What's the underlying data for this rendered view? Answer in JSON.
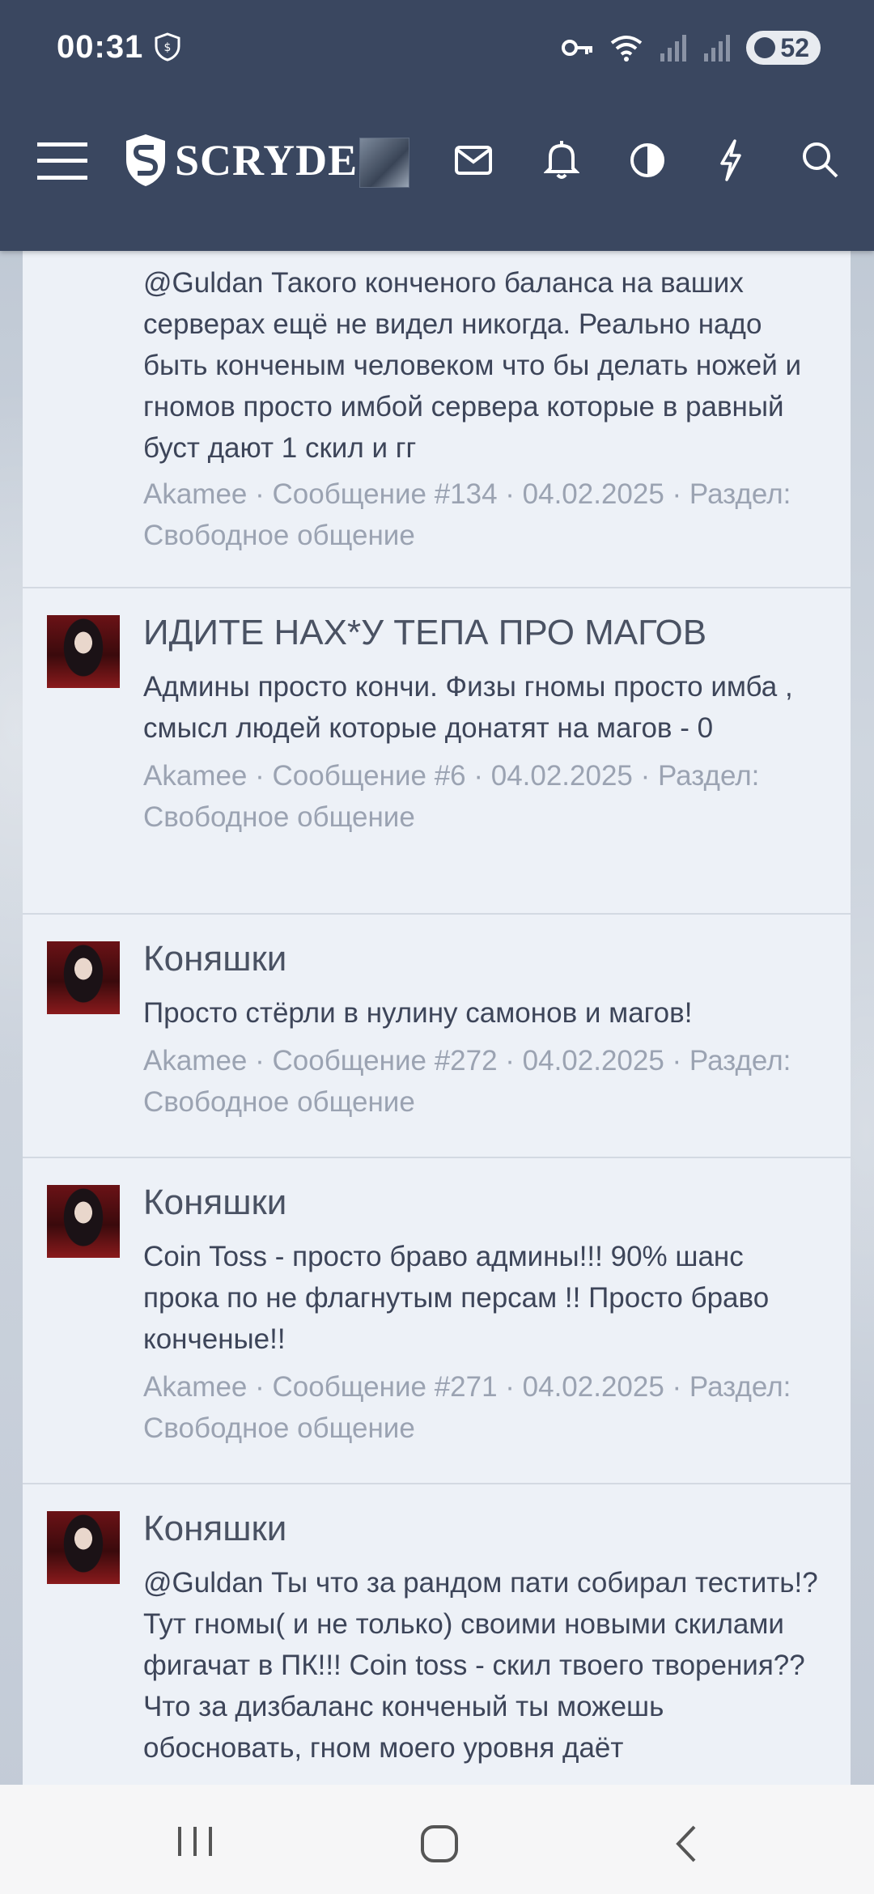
{
  "status_bar": {
    "time": "00:31",
    "battery": "52"
  },
  "header": {
    "logo_text": "SCRYDE",
    "icons": [
      "menu-icon",
      "mail-icon",
      "bell-icon",
      "theme-toggle-icon",
      "lightning-icon",
      "search-icon"
    ]
  },
  "posts": [
    {
      "title": "",
      "text": "@Guldan Такого конченого баланса на ваших серверах ещё не видел никогда. Реально надо быть конченым человеком что бы делать ножей и гномов просто имбой сервера которые в равный буст дают 1 скил и гг",
      "meta": "Akamee · Сообщение #134 · 04.02.2025 · Раздел: Свободное общение"
    },
    {
      "title": "ИДИТЕ НАХ*У ТЕПА ПРО МАГОВ",
      "text": "Админы просто кончи. Физы гномы просто имба , смысл людей которые донатят на магов - 0",
      "meta": "Akamee · Сообщение #6 · 04.02.2025 · Раздел: Свободное общение"
    },
    {
      "title": "Коняшки",
      "text": "Просто стёрли в нулину самонов и магов!",
      "meta": "Akamee · Сообщение #272 · 04.02.2025 · Раздел: Свободное общение"
    },
    {
      "title": "Коняшки",
      "text": "Coin Toss - просто браво админы!!! 90% шанс прока по не флагнутым персам !! Просто браво конченые!!",
      "meta": "Akamee · Сообщение #271 · 04.02.2025 · Раздел: Свободное общение"
    },
    {
      "title": "Коняшки",
      "text": "@Guldan Ты что за рандом пати собирал тестить!? Тут гномы( и не только) своими новыми скилами фигачат в ПК!!! Coin toss - скил твоего творения?? Что за дизбаланс конченый ты можешь обосновать, гном моего уровня даёт",
      "meta": ""
    }
  ],
  "colors": {
    "header_bg": "#3a4760",
    "panel_bg": "#edf1f7",
    "text": "#3d4559",
    "meta": "#9ba3b2"
  }
}
